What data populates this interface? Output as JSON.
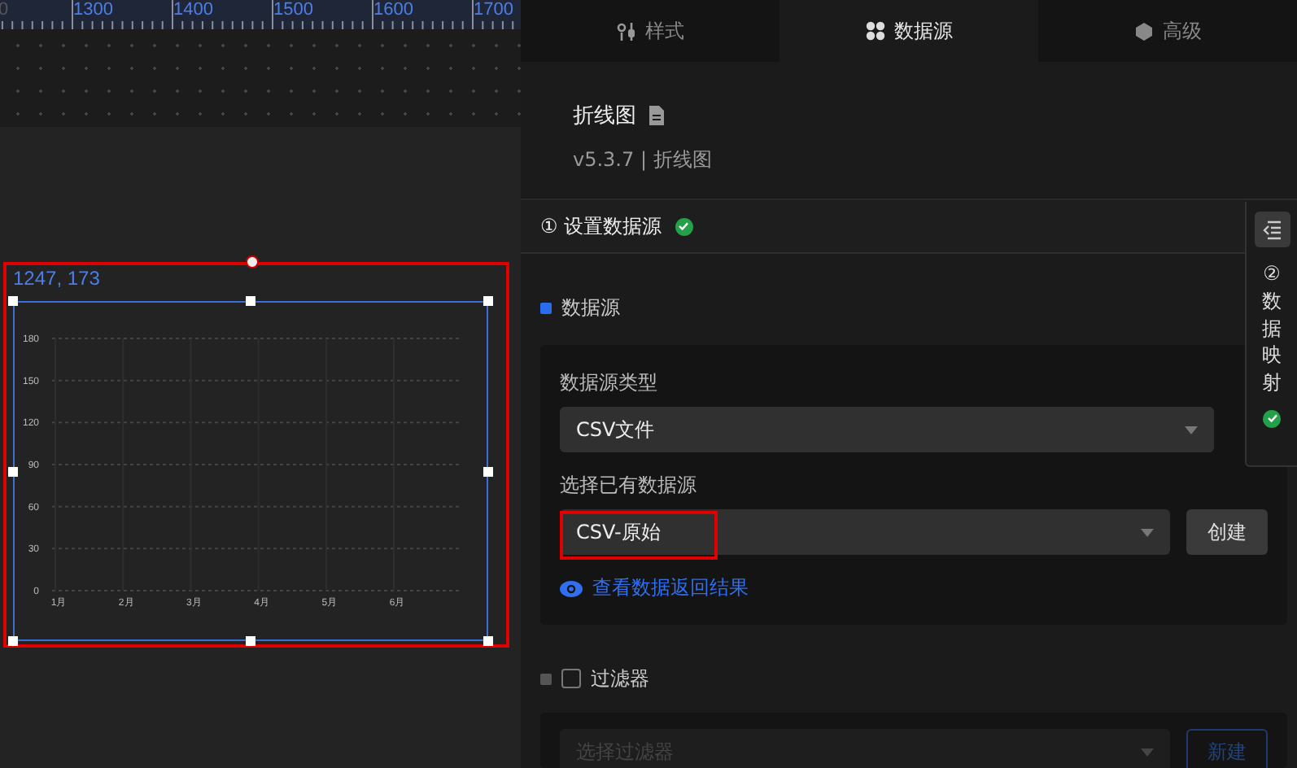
{
  "ruler": {
    "labels": [
      "0",
      "1300",
      "1400",
      "1500",
      "1600",
      "1700"
    ]
  },
  "canvas": {
    "position": "1247, 173",
    "widget": {
      "selected": true,
      "highlight": true,
      "chart_data": {
        "type": "line",
        "categories": [
          "1月",
          "2月",
          "3月",
          "4月",
          "5月",
          "6月"
        ],
        "ylim": [
          0,
          180
        ],
        "grid": true,
        "yticks": [
          0,
          30,
          60,
          90,
          120,
          150,
          180
        ]
      }
    }
  },
  "tabs": [
    {
      "label": "样式",
      "selected": false
    },
    {
      "label": "数据源",
      "selected": true
    },
    {
      "label": "高级",
      "selected": false
    }
  ],
  "component": {
    "title": "折线图",
    "version": "v5.3.7 | 折线图"
  },
  "step": {
    "label": "① 设置数据源",
    "done": true
  },
  "side_step": {
    "label": "②数据映射",
    "done": true
  },
  "datasource": {
    "heading": "数据源",
    "fields": [
      {
        "label": "数据源类型",
        "value": "CSV文件"
      },
      {
        "label": "选择已有数据源",
        "value": "CSV-原始",
        "highlight": true,
        "button": "创建"
      }
    ],
    "link": "查看数据返回结果"
  },
  "filter": {
    "heading": "过滤器",
    "checked": false,
    "placeholder": "选择过滤器",
    "disabled": true,
    "button": "新建"
  }
}
